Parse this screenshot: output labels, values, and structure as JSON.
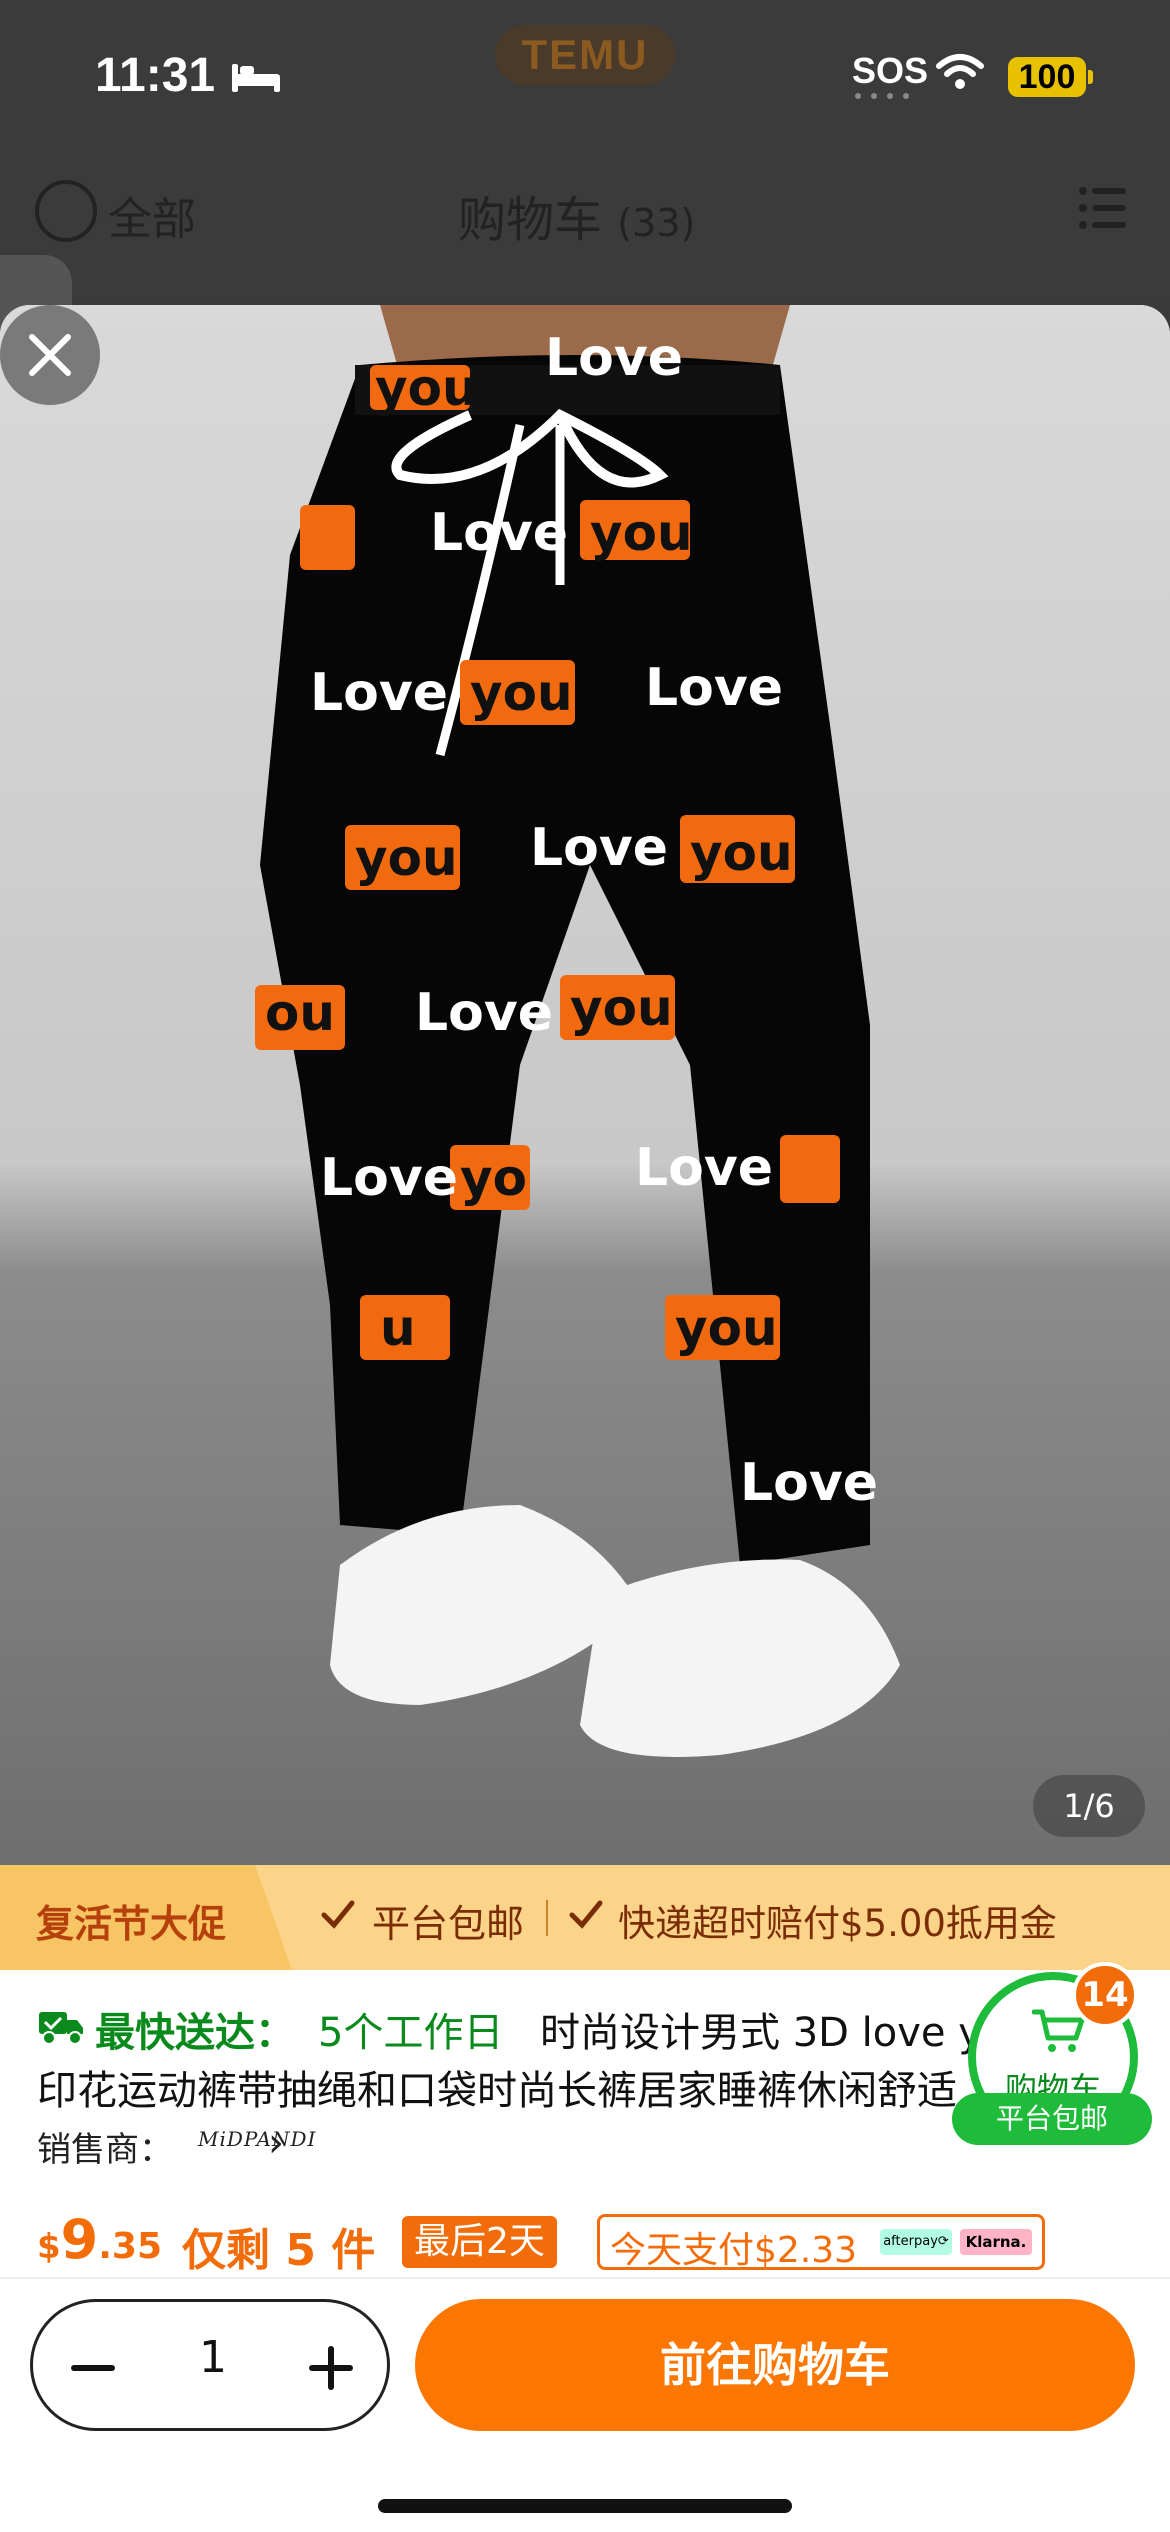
{
  "status_bar": {
    "time": "11:31",
    "sos": "SOS",
    "battery": "100",
    "logo": "TEMU"
  },
  "header": {
    "select_all": "全部",
    "title": "购物车",
    "count": "(33)"
  },
  "gallery": {
    "counter": "1/6"
  },
  "promo": {
    "title": "复活节大促",
    "free_shipping": "平台包邮",
    "compensation": "快递超时赔付$5.00抵用金"
  },
  "product": {
    "shipping_label": "最快送达：",
    "shipping_days": "5个工作日",
    "title_line1": "时尚设计男式 3D love you",
    "title_line2": "印花运动裤带抽绳和口袋时尚长裤居家睡裤休闲舒适",
    "seller_label": "销售商：",
    "seller_logo": "MiDPANDI",
    "price_currency": "$",
    "price_int": "9",
    "price_dec": ".35",
    "stock": "仅剩 5 件",
    "last_days": "最后2天",
    "pay_today": "今天支付$2.33",
    "afterpay": "afterpay⟳",
    "klarna": "Klarna."
  },
  "cart_fab": {
    "label": "购物车",
    "badge": "14",
    "pill": "平台包邮"
  },
  "bottom": {
    "quantity": "1",
    "go_cart": "前往购物车"
  },
  "colors": {
    "accent": "#fb7701",
    "green": "#1ebc3a",
    "promo_bg": "#fbd48a"
  }
}
